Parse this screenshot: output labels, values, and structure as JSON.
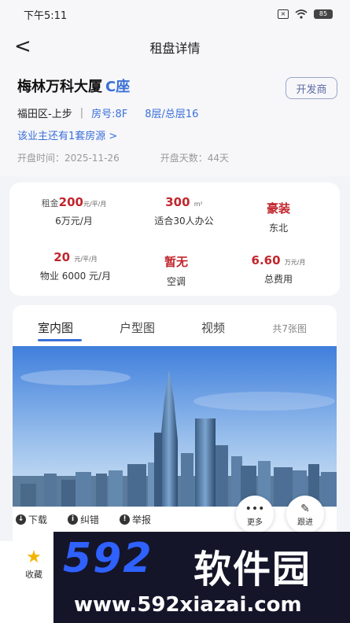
{
  "status_bar": {
    "time": "下午5:11",
    "battery": "85"
  },
  "header": {
    "back": "<",
    "title": "租盘详情"
  },
  "listing": {
    "name": "梅林万科大厦",
    "seat": "C座",
    "developer_button": "开发商",
    "district": "福田区-上步",
    "separator": "|",
    "room": "房号:8F",
    "floor": "8层/总层16",
    "more_listings": "该业主还有1套房源 >",
    "open_date": "开盘时间：2025-11-26",
    "open_days": "开盘天数：44天"
  },
  "stats": {
    "rent_prefix": "租金",
    "rent_value": "200",
    "rent_unit": "元/平/月",
    "rent_sub": "6万元/月",
    "area_value": "300",
    "area_unit": "m²",
    "area_sub": "适合30人办公",
    "decor_value": "豪装",
    "decor_sub": "东北",
    "property_value": "20",
    "property_unit": "元/平/月",
    "property_sub": "物业 6000 元/月",
    "ac_value": "暂无",
    "ac_sub": "空调",
    "total_value": "6.60",
    "total_unit": "万元/月",
    "total_sub": "总费用"
  },
  "gallery": {
    "tabs": [
      "室内图",
      "户型图",
      "视频"
    ],
    "count": "共7张图"
  },
  "actions": {
    "download": "下载",
    "error": "纠错",
    "report": "举报"
  },
  "fabs": {
    "more": "更多",
    "follow": "跟进"
  },
  "bottom": {
    "favorite": "收藏"
  },
  "watermark": {
    "brand": "592",
    "cn": "软件园",
    "url": "www.592xiazai.com"
  },
  "colors": {
    "accent": "#3a6fd8",
    "price_red": "#c0262d",
    "sky_top": "#4f8be0",
    "sky_bottom": "#c9ddf3"
  }
}
